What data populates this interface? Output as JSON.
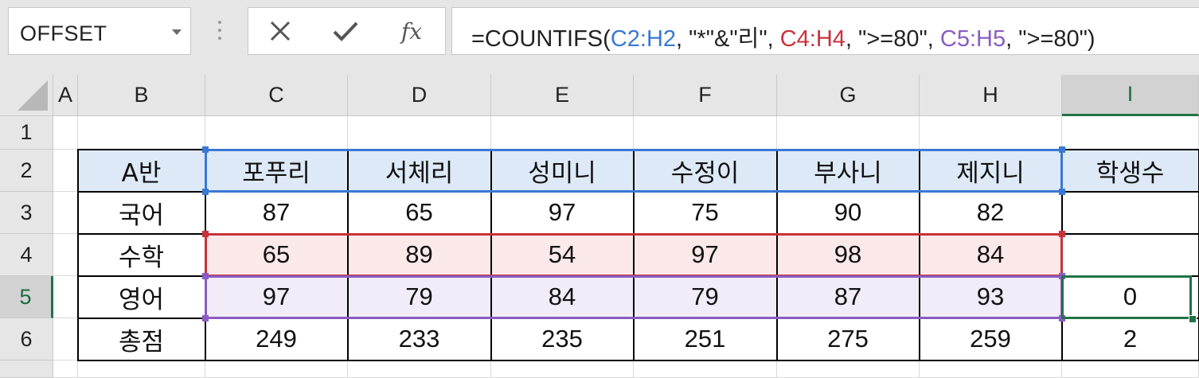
{
  "name_box": {
    "value": "OFFSET"
  },
  "formula_bar": {
    "cancel_icon": "close-icon",
    "enter_icon": "check-icon",
    "function_label": "fx",
    "formula_parts": [
      {
        "text": "=COUNTIFS(",
        "color": "#222222"
      },
      {
        "text": "C2:H2",
        "color": "#3a78d4"
      },
      {
        "text": ", \"*\"&\"리\", ",
        "color": "#222222"
      },
      {
        "text": "C4:H4",
        "color": "#c8323c"
      },
      {
        "text": ", \">=80\", ",
        "color": "#222222"
      },
      {
        "text": "C5:H5",
        "color": "#8a5cc2"
      },
      {
        "text": ", \">=80\")",
        "color": "#222222"
      }
    ]
  },
  "columns": [
    "A",
    "B",
    "C",
    "D",
    "E",
    "F",
    "G",
    "H",
    "I"
  ],
  "rows": [
    "1",
    "2",
    "3",
    "4",
    "5",
    "6"
  ],
  "selected_column": "I",
  "selected_row": "5",
  "table": {
    "header": [
      "A반",
      "포푸리",
      "서체리",
      "성미니",
      "수정이",
      "부사니",
      "제지니",
      "학생수"
    ],
    "body": [
      [
        "국어",
        "87",
        "65",
        "97",
        "75",
        "90",
        "82",
        ""
      ],
      [
        "수학",
        "65",
        "89",
        "54",
        "97",
        "98",
        "84",
        ""
      ],
      [
        "영어",
        "97",
        "79",
        "84",
        "79",
        "87",
        "93",
        "0"
      ],
      [
        "총점",
        "249",
        "233",
        "235",
        "251",
        "275",
        "259",
        "2"
      ]
    ]
  },
  "reference_colors": {
    "blue": "#3a78d4",
    "red": "#c8323c",
    "purple": "#8a5cc2",
    "active": "#217346"
  }
}
